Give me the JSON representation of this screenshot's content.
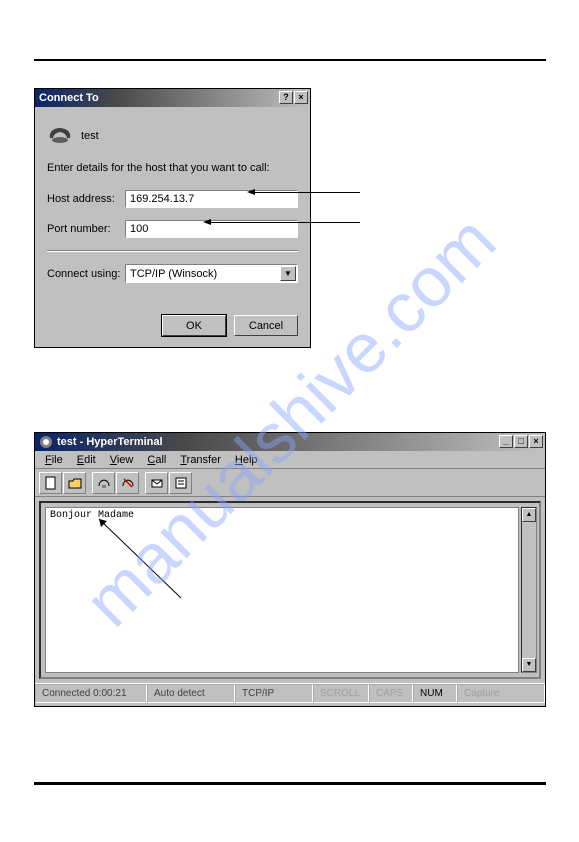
{
  "watermark": "manualshive.com",
  "dialog": {
    "title": "Connect To",
    "icon_label": "test",
    "instruction": "Enter details for the host that you want to call:",
    "host_label": "Host address:",
    "host_value": "169.254.13.7",
    "port_label": "Port number:",
    "port_value": "100",
    "connect_using_label": "Connect using:",
    "connect_using_value": "TCP/IP (Winsock)",
    "ok": "OK",
    "cancel": "Cancel",
    "help_btn": "?",
    "close_btn": "×"
  },
  "app": {
    "title": "test - HyperTerminal",
    "min_btn": "_",
    "max_btn": "□",
    "close_btn": "×",
    "menu": [
      "File",
      "Edit",
      "View",
      "Call",
      "Transfer",
      "Help"
    ],
    "terminal_text": "Bonjour Madame",
    "status": {
      "connected": "Connected 0:00:21",
      "autodetect": "Auto detect",
      "protocol": "TCP/IP",
      "scroll": "SCROLL",
      "caps": "CAPS",
      "num": "NUM",
      "capture": "Capture"
    }
  }
}
